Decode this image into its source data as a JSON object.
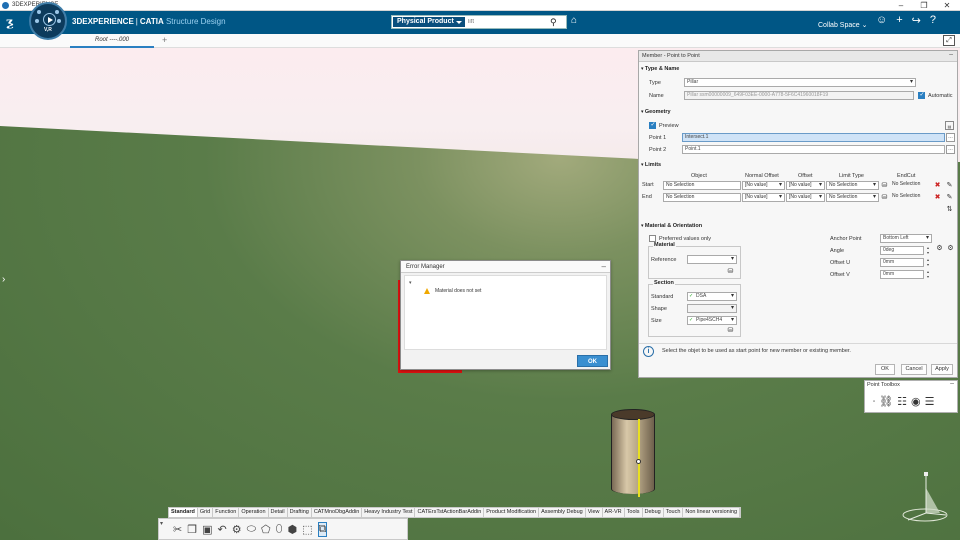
{
  "os": {
    "title": "3DEXPERIENCE"
  },
  "header": {
    "brand_bold": "3DEXPERIENCE",
    "brand_sep": "|",
    "brand_name": "CATIA",
    "brand_app": "Structure Design",
    "compass_label": "V,R",
    "search_context": "Physical Product",
    "search_placeholder": "lift",
    "collab_space": "Collab Space"
  },
  "tabs": {
    "root": "Root ----.000",
    "add": "+"
  },
  "member_dialog": {
    "title": "Member - Point to Point",
    "type_name_header": "Type & Name",
    "type_label": "Type",
    "type_value": "Pillar",
    "name_label": "Name",
    "name_value": "Pillar ssm00000009_649F03EE-0000-A778-5F6C41960018F19",
    "automatic_label": "Automatic",
    "automatic_checked": true,
    "geometry_header": "Geometry",
    "preview_label": "Preview",
    "point1_label": "Point 1",
    "point1_value": "Intersect.1",
    "point2_label": "Point 2",
    "point2_value": "Point.1",
    "limits_header": "Limits",
    "limits_columns": [
      "Object",
      "Normal Offset",
      "Offset",
      "Limit Type",
      "EndCut"
    ],
    "limits_rows": [
      {
        "label": "Start",
        "object": "No Selection",
        "normal_offset": "[No value]",
        "offset": "[No value]",
        "limit_type": "No Selection",
        "endcut": "No Selection"
      },
      {
        "label": "End",
        "object": "No Selection",
        "normal_offset": "[No value]",
        "offset": "[No value]",
        "limit_type": "No Selection",
        "endcut": "No Selection"
      }
    ],
    "mat_header": "Material & Orientation",
    "preferred_label": "Preferred values only",
    "material_group": "Material",
    "reference_label": "Reference",
    "section_group": "Section",
    "standard_label": "Standard",
    "standard_value": "DSA",
    "shape_label": "Shape",
    "size_label": "Size",
    "size_value": "Pipe4SCH4",
    "anchor_label": "Anchor Point",
    "anchor_value": "Bottom Left",
    "angle_label": "Angle",
    "angle_value": "0deg",
    "offsetu_label": "Offset U",
    "offsetu_value": "0mm",
    "offsetv_label": "Offset V",
    "offsetv_value": "0mm",
    "info_text": "Select the objet to be used as start point for new member or existing member.",
    "ok": "OK",
    "cancel": "Cancel",
    "apply": "Apply"
  },
  "error_manager": {
    "title": "Error Manager",
    "message": "Material does not set",
    "ok": "OK"
  },
  "point_toolbox": {
    "title": "Point Toolbox"
  },
  "action_bar": {
    "tabs": [
      "Standard",
      "Grid",
      "Function",
      "Operation",
      "Detail",
      "Drafting",
      "CATMnoDbgAddin",
      "Heavy Industry Test",
      "CATErsTstActionBarAddin",
      "Product Modification",
      "Assembly Debug",
      "View",
      "AR-VR",
      "Tools",
      "Debug",
      "Touch",
      "Non linear versioning"
    ],
    "active_tab": "Standard"
  },
  "colors": {
    "header": "#005685",
    "accent": "#2a7fc1",
    "error": "#e01010",
    "ground": "#4f7440"
  }
}
